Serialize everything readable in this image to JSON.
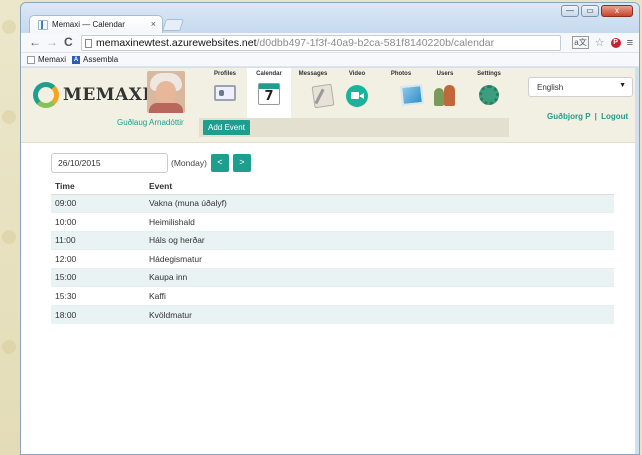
{
  "browser": {
    "tab_title": "Memaxi — Calendar",
    "tab_close": "×",
    "url_host": "memaxinewtest.azurewebsites.net",
    "url_path": "/d0dbb497-1f3f-40a9-b2ca-581f8140220b/calendar",
    "back_glyph": "←",
    "forward_glyph": "→",
    "reload_glyph": "C",
    "bookmarks": [
      {
        "label": "Memaxi",
        "icon": "page-icon"
      },
      {
        "label": "Assembla",
        "icon": "assembla-icon",
        "glyph": "A"
      }
    ],
    "window_controls": {
      "minimize": "—",
      "maximize": "▭",
      "close": "x"
    }
  },
  "app": {
    "logo_text": "MEMAXI",
    "user_name": "Guðlaug Arnadóttir",
    "nav": [
      {
        "label": "Profiles",
        "icon": "profiles-icon"
      },
      {
        "label": "Calendar",
        "icon": "calendar-icon",
        "active": true,
        "glyph": "7"
      },
      {
        "label": "Messages",
        "icon": "messages-icon"
      },
      {
        "label": "Video",
        "icon": "video-icon"
      },
      {
        "label": "Photos",
        "icon": "photos-icon"
      },
      {
        "label": "Users",
        "icon": "users-icon"
      },
      {
        "label": "Settings",
        "icon": "settings-icon"
      }
    ],
    "add_event_label": "Add Event",
    "language": "English",
    "caregiver": "Guðbjorg P",
    "separator": "|",
    "logout_label": "Logout",
    "accent_color": "#1e9e8e"
  },
  "calendar": {
    "date_value": "26/10/2015",
    "weekday": "(Monday)",
    "prev_label": "<",
    "next_label": ">",
    "columns": {
      "time": "Time",
      "event": "Event"
    },
    "events": [
      {
        "time": "09:00",
        "event": "Vakna (muna úðalyf)"
      },
      {
        "time": "10:00",
        "event": "Heimilishald"
      },
      {
        "time": "11:00",
        "event": "Háls og herðar"
      },
      {
        "time": "12:00",
        "event": "Hádegismatur"
      },
      {
        "time": "15:00",
        "event": "Kaupa inn"
      },
      {
        "time": "15:30",
        "event": "Kaffi"
      },
      {
        "time": "18:00",
        "event": "Kvöldmatur"
      }
    ]
  }
}
